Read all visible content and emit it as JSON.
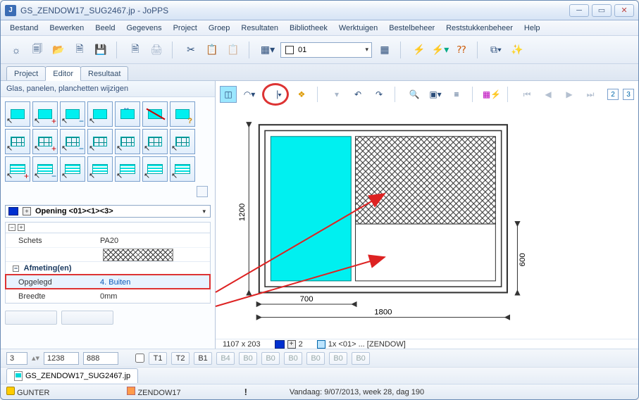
{
  "title": "GS_ZENDOW17_SUG2467.jp - JoPPS",
  "menu": [
    "Bestand",
    "Bewerken",
    "Beeld",
    "Gegevens",
    "Project",
    "Groep",
    "Resultaten",
    "Bibliotheek",
    "Werktuigen",
    "Bestelbeheer",
    "Reststukkenbeheer",
    "Help"
  ],
  "toolbar_combo": "01",
  "tabs": [
    "Project",
    "Editor",
    "Resultaat"
  ],
  "active_tab": "Editor",
  "panel_title": "Glas, panelen, planchetten wijzigen",
  "opening_label": "Opening <01><1><3>",
  "props": {
    "schets_label": "Schets",
    "schets_value": "PA20",
    "section_label": "Afmeting(en)",
    "opgelegd_label": "Opgelegd",
    "opgelegd_value": "4. Buiten",
    "breedte_label": "Breedte",
    "breedte_value": "0mm"
  },
  "canvas": {
    "dim_left": "1200",
    "dim_bottom_left": "700",
    "dim_bottom_full": "1800",
    "dim_right": "600"
  },
  "status": {
    "coords": "1107 x 203",
    "count": "2",
    "assembly": "1x <01> ... [ZENDOW]"
  },
  "bottom": {
    "v1": "3",
    "v2": "1238",
    "v3": "888",
    "chips": [
      "T1",
      "T2",
      "B1",
      "B4",
      "B0",
      "B0",
      "B0",
      "B0",
      "B0",
      "B0"
    ]
  },
  "filetab": "GS_ZENDOW17_SUG2467.jp",
  "statusbar": {
    "user": "GUNTER",
    "project": "ZENDOW17",
    "date": "Vandaag: 9/07/2013, week 28, dag 190"
  }
}
